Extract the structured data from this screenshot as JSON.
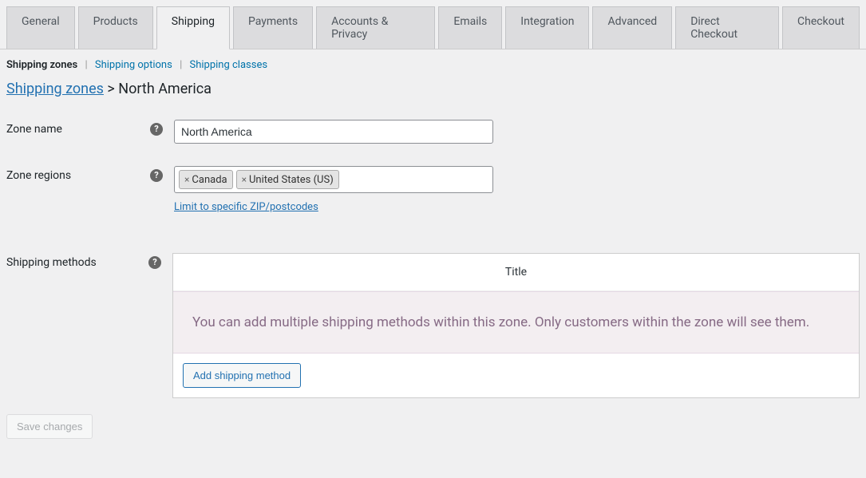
{
  "tabs": {
    "general": "General",
    "products": "Products",
    "shipping": "Shipping",
    "payments": "Payments",
    "accounts": "Accounts & Privacy",
    "emails": "Emails",
    "integration": "Integration",
    "advanced": "Advanced",
    "direct_checkout": "Direct Checkout",
    "checkout": "Checkout"
  },
  "subtabs": {
    "zones": "Shipping zones",
    "options": "Shipping options",
    "classes": "Shipping classes"
  },
  "breadcrumb": {
    "parent": "Shipping zones",
    "sep": ">",
    "current": "North America"
  },
  "form": {
    "zone_name_label": "Zone name",
    "zone_name_value": "North America",
    "zone_regions_label": "Zone regions",
    "region_tags": [
      "Canada",
      "United States (US)"
    ],
    "limit_link": "Limit to specific ZIP/postcodes",
    "methods_label": "Shipping methods",
    "table_title_header": "Title",
    "empty_message": "You can add multiple shipping methods within this zone. Only customers within the zone will see them.",
    "add_method_btn": "Add shipping method",
    "save_btn": "Save changes"
  }
}
